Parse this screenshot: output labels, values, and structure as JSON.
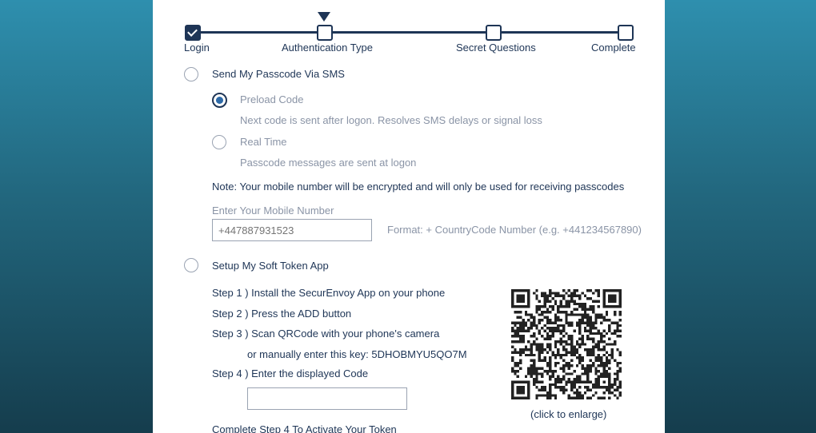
{
  "progress": {
    "steps": [
      {
        "label": "Login",
        "state": "done"
      },
      {
        "label": "Authentication Type",
        "state": "current"
      },
      {
        "label": "Secret Questions",
        "state": "pending"
      },
      {
        "label": "Complete",
        "state": "pending"
      }
    ]
  },
  "sms": {
    "label": "Send My Passcode Via SMS",
    "preload": {
      "label": "Preload Code",
      "desc": "Next code is sent after logon. Resolves SMS delays or signal loss"
    },
    "realtime": {
      "label": "Real Time",
      "desc": "Passcode messages are sent at logon"
    },
    "note": "Note: Your mobile number will be encrypted and will only be used for receiving passcodes",
    "mobile_label": "Enter Your Mobile Number",
    "mobile_placeholder": "+447887931523",
    "format_hint": "Format: + CountryCode Number (e.g. +441234567890)"
  },
  "soft_token": {
    "label": "Setup My Soft Token App",
    "step1": "Step 1 ) Install the SecurEnvoy App on your phone",
    "step2": "Step 2 ) Press the ADD button",
    "step3": "Step 3 ) Scan QRCode with your phone's camera",
    "manual_key": "or manually enter this key: 5DHOBMYU5QO7M",
    "step4": "Step 4 ) Enter the displayed Code",
    "code_value": "",
    "qr_hint": "(click to enlarge)",
    "activate_note": "Complete Step 4 To Activate Your Token"
  },
  "colors": {
    "navy": "#1e3556",
    "grey_text": "#8a94a6",
    "accent": "#2d6aa8"
  }
}
